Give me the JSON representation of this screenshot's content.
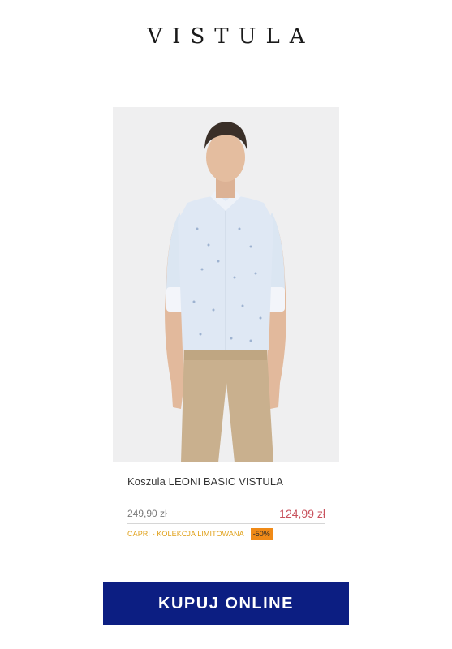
{
  "brand": {
    "logo_text": "VISTULA"
  },
  "product": {
    "image_alt": "Model in light blue patterned shirt and beige chinos",
    "name": "Koszula LEONI BASIC VISTULA",
    "old_price": "249,90 zł",
    "new_price": "124,99 zł",
    "promo_label": "CAPRI - KOLEKCJA LIMITOWANA",
    "discount": "-50%"
  },
  "cta": {
    "label": "KUPUJ ONLINE"
  },
  "colors": {
    "cta_background": "#0c1e82",
    "new_price": "#c8515c",
    "promo_text": "#e0a11a",
    "discount_badge": "#f08a17"
  }
}
